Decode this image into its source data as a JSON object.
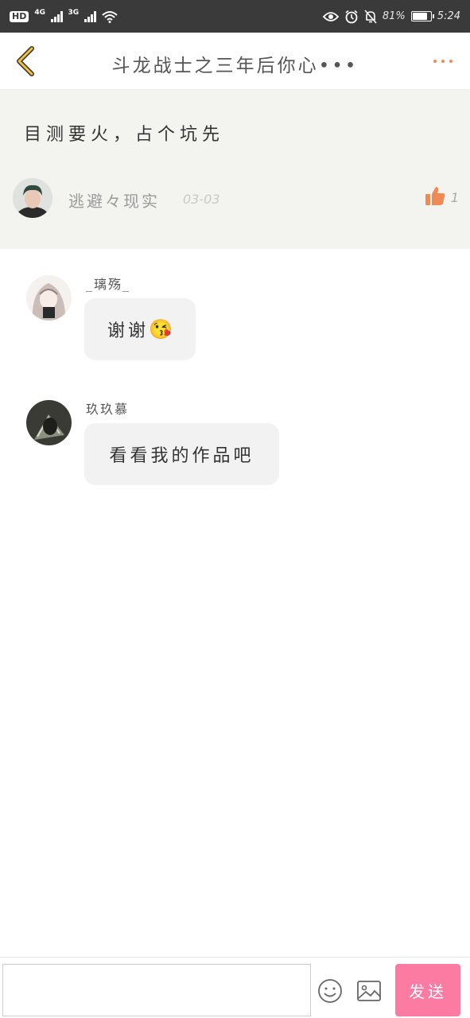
{
  "status_bar": {
    "left": {
      "hd": "HD",
      "net_a": "4G",
      "net_b": "3G"
    },
    "right": {
      "battery_percent": "81%",
      "battery_level": 0.81,
      "time": "5:24"
    },
    "icons": [
      "hd-icon",
      "signal-4g-icon",
      "signal-3g-icon",
      "wifi-icon",
      "eye-icon",
      "alarm-icon",
      "bell-muted-icon",
      "battery-icon"
    ]
  },
  "header": {
    "title": "斗龙战士之三年后你心•••",
    "back_icon": "chevron-left-icon",
    "more_icon": "more-dots-icon",
    "accent": "#f08a55",
    "back_color": "#f3c13a"
  },
  "post": {
    "text": "目测要火，占个坑先",
    "author": "逃避々现实",
    "date": "03-03",
    "likes": "1",
    "like_icon": "thumbs-up-icon",
    "like_color": "#f08a55"
  },
  "replies": [
    {
      "name": "_璃殇_",
      "text": "谢谢",
      "emoji": "😘"
    },
    {
      "name": "玖玖慕",
      "text": "看看我的作品吧"
    }
  ],
  "composer": {
    "value": "",
    "placeholder": "",
    "emoji_icon": "smiley-icon",
    "image_icon": "image-icon",
    "send_label": "发送",
    "send_color": "#fb7ba2"
  }
}
